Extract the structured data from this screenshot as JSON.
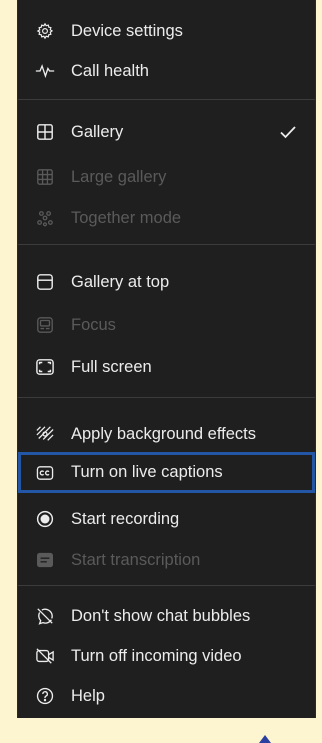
{
  "menu": {
    "items": [
      {
        "label": "Device settings",
        "icon": "gear-icon",
        "enabled": true
      },
      {
        "label": "Call health",
        "icon": "pulse-icon",
        "enabled": true
      },
      {
        "label": "Gallery",
        "icon": "grid-icon",
        "enabled": true,
        "checked": true
      },
      {
        "label": "Large gallery",
        "icon": "large-grid-icon",
        "enabled": false
      },
      {
        "label": "Together mode",
        "icon": "people-group-icon",
        "enabled": false
      },
      {
        "label": "Gallery at top",
        "icon": "gallery-top-icon",
        "enabled": true
      },
      {
        "label": "Focus",
        "icon": "focus-icon",
        "enabled": false
      },
      {
        "label": "Full screen",
        "icon": "full-screen-icon",
        "enabled": true
      },
      {
        "label": "Apply background effects",
        "icon": "background-effects-icon",
        "enabled": true
      },
      {
        "label": "Turn on live captions",
        "icon": "closed-captions-icon",
        "enabled": true,
        "highlighted": true
      },
      {
        "label": "Start recording",
        "icon": "record-icon",
        "enabled": true
      },
      {
        "label": "Start transcription",
        "icon": "transcript-icon",
        "enabled": false
      },
      {
        "label": "Don't show chat bubbles",
        "icon": "chat-bubbles-off-icon",
        "enabled": true
      },
      {
        "label": "Turn off incoming video",
        "icon": "video-off-icon",
        "enabled": true
      },
      {
        "label": "Help",
        "icon": "help-icon",
        "enabled": true
      }
    ]
  },
  "colors": {
    "menu_background": "#1f1f1f",
    "text": "#ececec",
    "disabled_text": "#5a5a5a",
    "highlight_border": "#2456a6",
    "page_background": "#fdf5d0"
  }
}
